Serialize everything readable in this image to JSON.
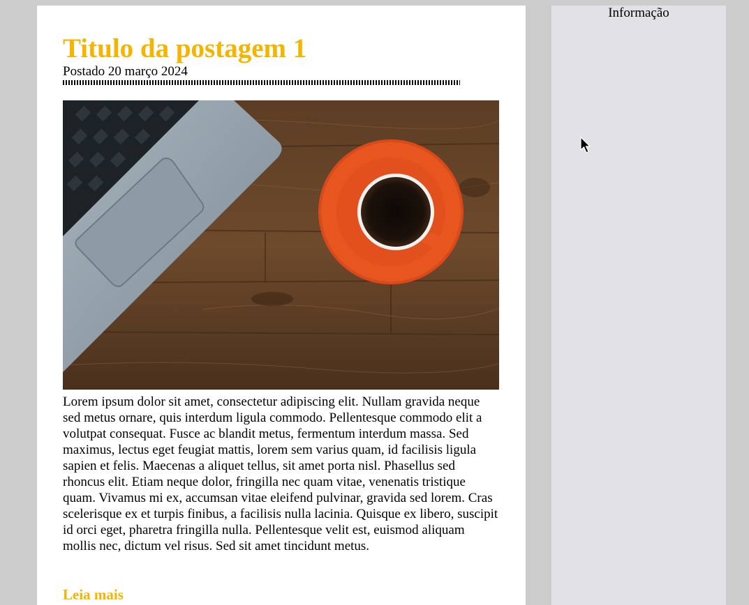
{
  "post": {
    "title": "Titulo da postagem 1",
    "date": "Postado 20 março 2024",
    "body": "Lorem ipsum dolor sit amet, consectetur adipiscing elit. Nullam gravida neque sed metus ornare, quis interdum ligula commodo. Pellentesque commodo elit a volutpat consequat. Fusce ac blandit metus, fermentum interdum massa. Sed maximus, lectus eget feugiat mattis, lorem sem varius quam, id facilisis ligula sapien et felis. Maecenas a aliquet tellus, sit amet porta nisl. Phasellus sed rhoncus elit. Etiam neque dolor, fringilla nec quam vitae, venenatis tristique quam. Vivamus mi ex, accumsan vitae eleifend pulvinar, gravida sed lorem. Cras scelerisque ex et turpis finibus, a facilisis nulla lacinia. Quisque ex libero, suscipit id orci eget, pharetra fringilla nulla. Pellentesque velit est, euismod aliquam mollis nec, dictum vel risus. Sed sit amet tincidunt metus.",
    "read_more": "Leia mais"
  },
  "sidebar": {
    "title": "Informação"
  },
  "colors": {
    "accent": "#f5b400",
    "page_background": "#cccccc",
    "card_background": "#ffffff",
    "sidebar_background": "#e1e1e6"
  },
  "icons": {
    "cursor": "mouse-pointer-icon"
  }
}
